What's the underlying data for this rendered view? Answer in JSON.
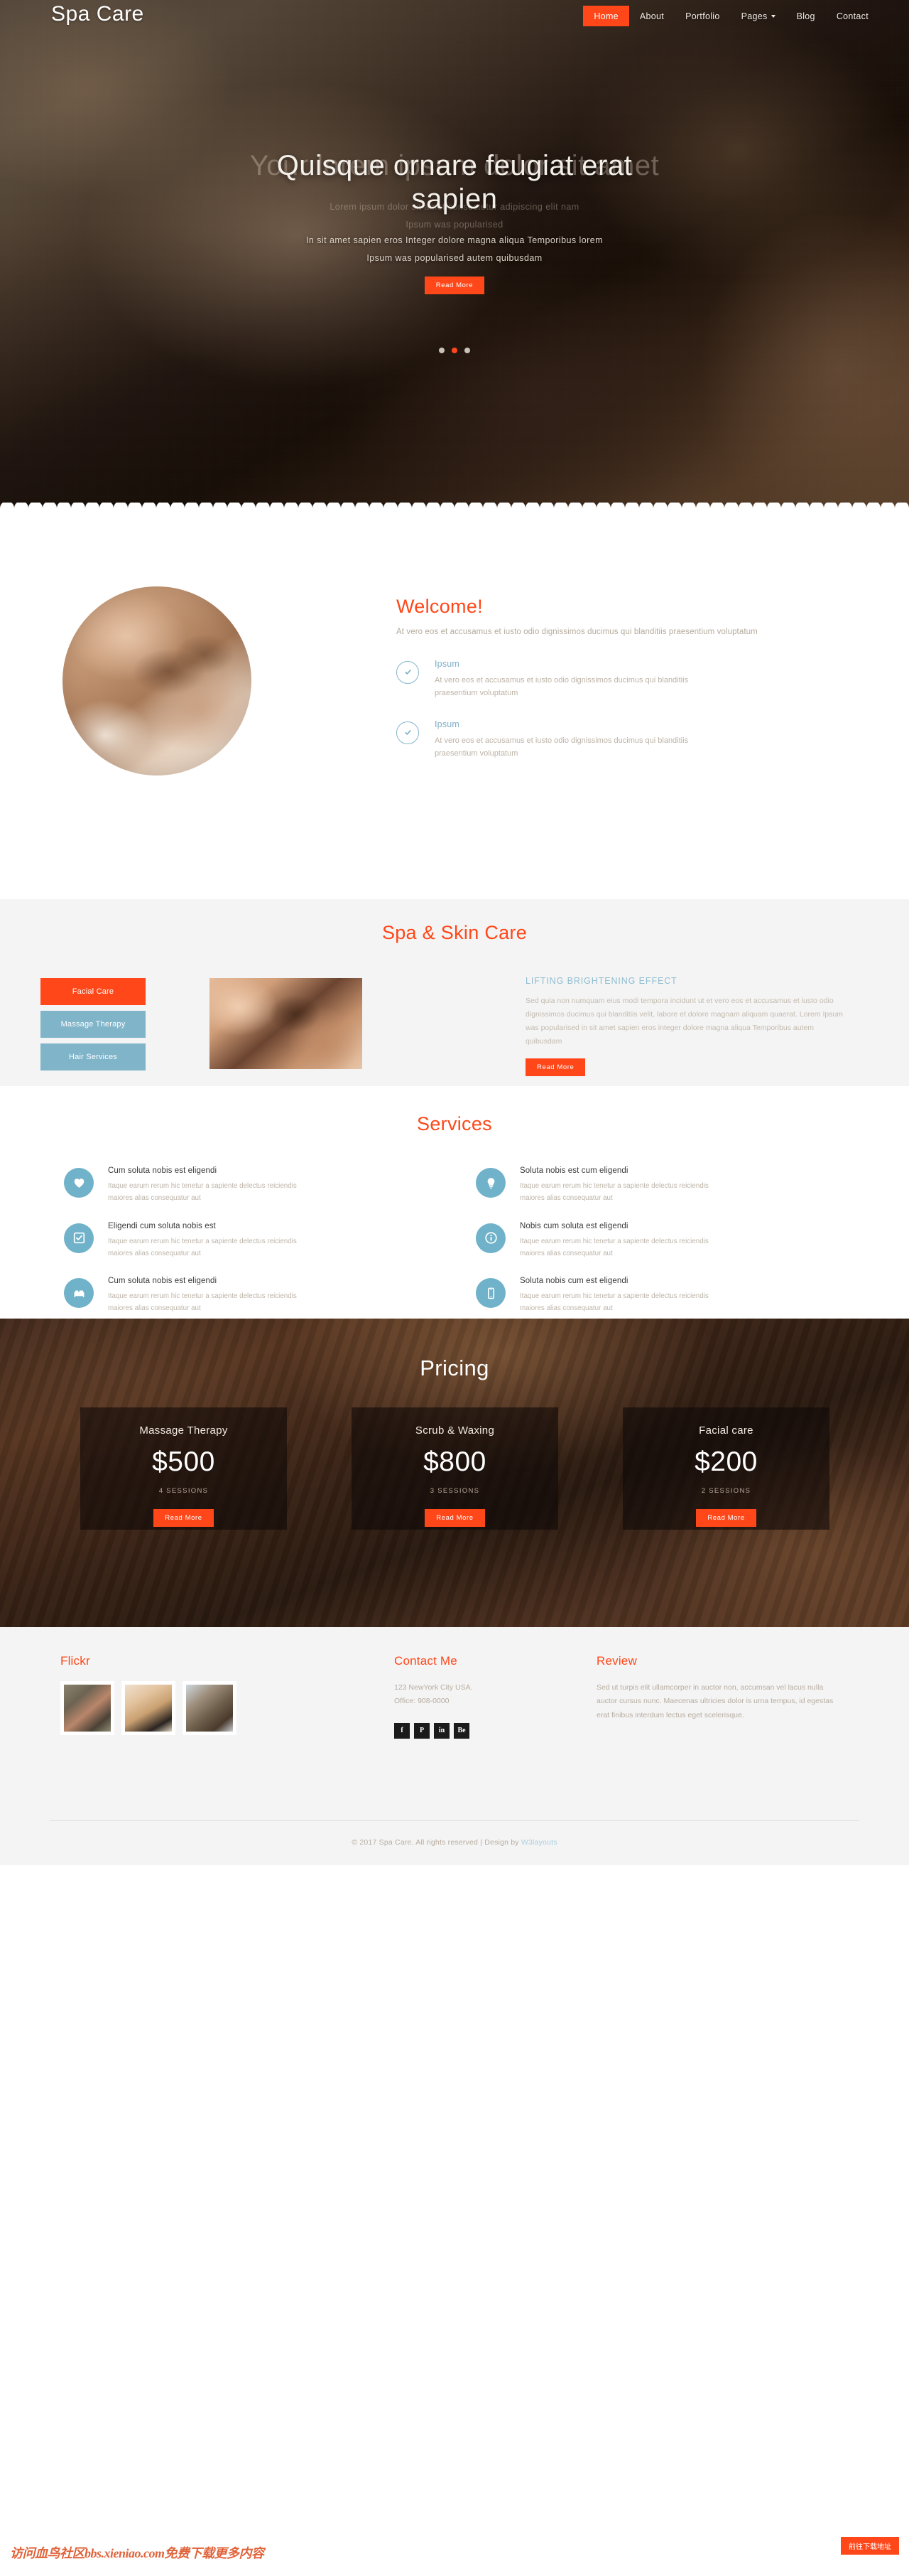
{
  "brand": "Spa Care",
  "nav": [
    {
      "label": "Home",
      "active": true,
      "caret": false
    },
    {
      "label": "About",
      "active": false,
      "caret": false
    },
    {
      "label": "Portfolio",
      "active": false,
      "caret": false
    },
    {
      "label": "Pages",
      "active": false,
      "caret": true
    },
    {
      "label": "Blog",
      "active": false,
      "caret": false
    },
    {
      "label": "Contact",
      "active": false,
      "caret": false
    }
  ],
  "hero": {
    "title_line1": "Quisque ornare feugiat erat",
    "title_line2": "sapien",
    "sub_line1": "In sit amet sapien eros Integer dolore magna aliqua Temporibus lorem",
    "sub_line2": "Ipsum was popularised autem quibusdam",
    "ghost_title_line1": "Your lorem ipsum dolor sit",
    "ghost_title_line2": "amet",
    "ghost_sub_line1": "Lorem ipsum dolor sit amet consectetur adipiscing elit nam",
    "ghost_sub_line2": "Ipsum was popularised",
    "button": "Read More",
    "dots": 3,
    "active_dot": 1
  },
  "welcome": {
    "heading": "Welcome!",
    "lead": "At vero eos et accusamus et iusto odio dignissimos ducimus qui blanditiis praesentium voluptatum",
    "features": [
      {
        "icon": "check-circle-icon",
        "title": "Ipsum",
        "text": "At vero eos et accusamus et iusto odio dignissimos ducimus qui blanditiis praesentium voluptatum"
      },
      {
        "icon": "check-circle-icon",
        "title": "Ipsum",
        "text": "At vero eos et accusamus et iusto odio dignissimos ducimus qui blanditiis praesentium voluptatum"
      }
    ]
  },
  "skin": {
    "heading": "Spa & Skin Care",
    "tabs": [
      {
        "label": "Facial Care",
        "active": true
      },
      {
        "label": "Massage Therapy",
        "active": false
      },
      {
        "label": "Hair Services",
        "active": false
      }
    ],
    "panel_title": "LIFTING BRIGHTENING EFFECT",
    "panel_text": "Sed quia non numquam eius modi tempora incidunt ut et vero eos et accusamus et iusto odio dignissimos ducimus qui blanditiis velit, labore et dolore magnam aliquam quaerat. Lorem Ipsum was popularised in sit amet sapien eros integer dolore magna aliqua Temporibus autem quibusdam",
    "button": "Read More"
  },
  "services": {
    "heading": "Services",
    "items": [
      {
        "icon": "heart-icon",
        "title": "Cum soluta nobis est eligendi",
        "text": "Itaque earum rerum hic tenetur a sapiente delectus reiciendis maiores alias consequatur aut"
      },
      {
        "icon": "lightbulb-icon",
        "title": "Soluta nobis est cum eligendi",
        "text": "Itaque earum rerum hic tenetur a sapiente delectus reiciendis maiores alias consequatur aut"
      },
      {
        "icon": "check-square-icon",
        "title": "Eligendi cum soluta nobis est",
        "text": "Itaque earum rerum hic tenetur a sapiente delectus reiciendis maiores alias consequatur aut"
      },
      {
        "icon": "info-icon",
        "title": "Nobis cum soluta est eligendi",
        "text": "Itaque earum rerum hic tenetur a sapiente delectus reiciendis maiores alias consequatur aut"
      },
      {
        "icon": "bed-icon",
        "title": "Cum soluta nobis est eligendi",
        "text": "Itaque earum rerum hic tenetur a sapiente delectus reiciendis maiores alias consequatur aut"
      },
      {
        "icon": "mobile-icon",
        "title": "Soluta nobis cum est eligendi",
        "text": "Itaque earum rerum hic tenetur a sapiente delectus reiciendis maiores alias consequatur aut"
      }
    ]
  },
  "pricing": {
    "heading": "Pricing",
    "cards": [
      {
        "title": "Massage Therapy",
        "price": "$500",
        "sessions": "4 SESSIONS",
        "button": "Read More"
      },
      {
        "title": "Scrub & Waxing",
        "price": "$800",
        "sessions": "3 SESSIONS",
        "button": "Read More"
      },
      {
        "title": "Facial care",
        "price": "$200",
        "sessions": "2 SESSIONS",
        "button": "Read More"
      }
    ]
  },
  "footer": {
    "flickr_heading": "Flickr",
    "contact_heading": "Contact Me",
    "review_heading": "Review",
    "address_line1": "123 NewYork City USA.",
    "address_line2": "Office: 908-0000",
    "social": [
      "f",
      "P",
      "in",
      "Be"
    ],
    "review_text": "Sed ut turpis elit ullamcorper in auctor non, accumsan vel lacus nulla auctor cursus nunc. Maecenas ultricies dolor is urna tempus, id egestas erat finibus interdum lectus eget scelerisque.",
    "copyright_prefix": "© 2017 Spa Care. All rights reserved | Design by ",
    "copyright_link": "W3layouts"
  },
  "watermark": "访问血鸟社区bbs.xieniao.com免费下载更多内容",
  "cta_button": "前往下载地址",
  "colors": {
    "accent": "#ff4719",
    "blue": "#6fb2c9",
    "muted": "#b7ada0",
    "panel_bg": "#f4f4f4"
  }
}
